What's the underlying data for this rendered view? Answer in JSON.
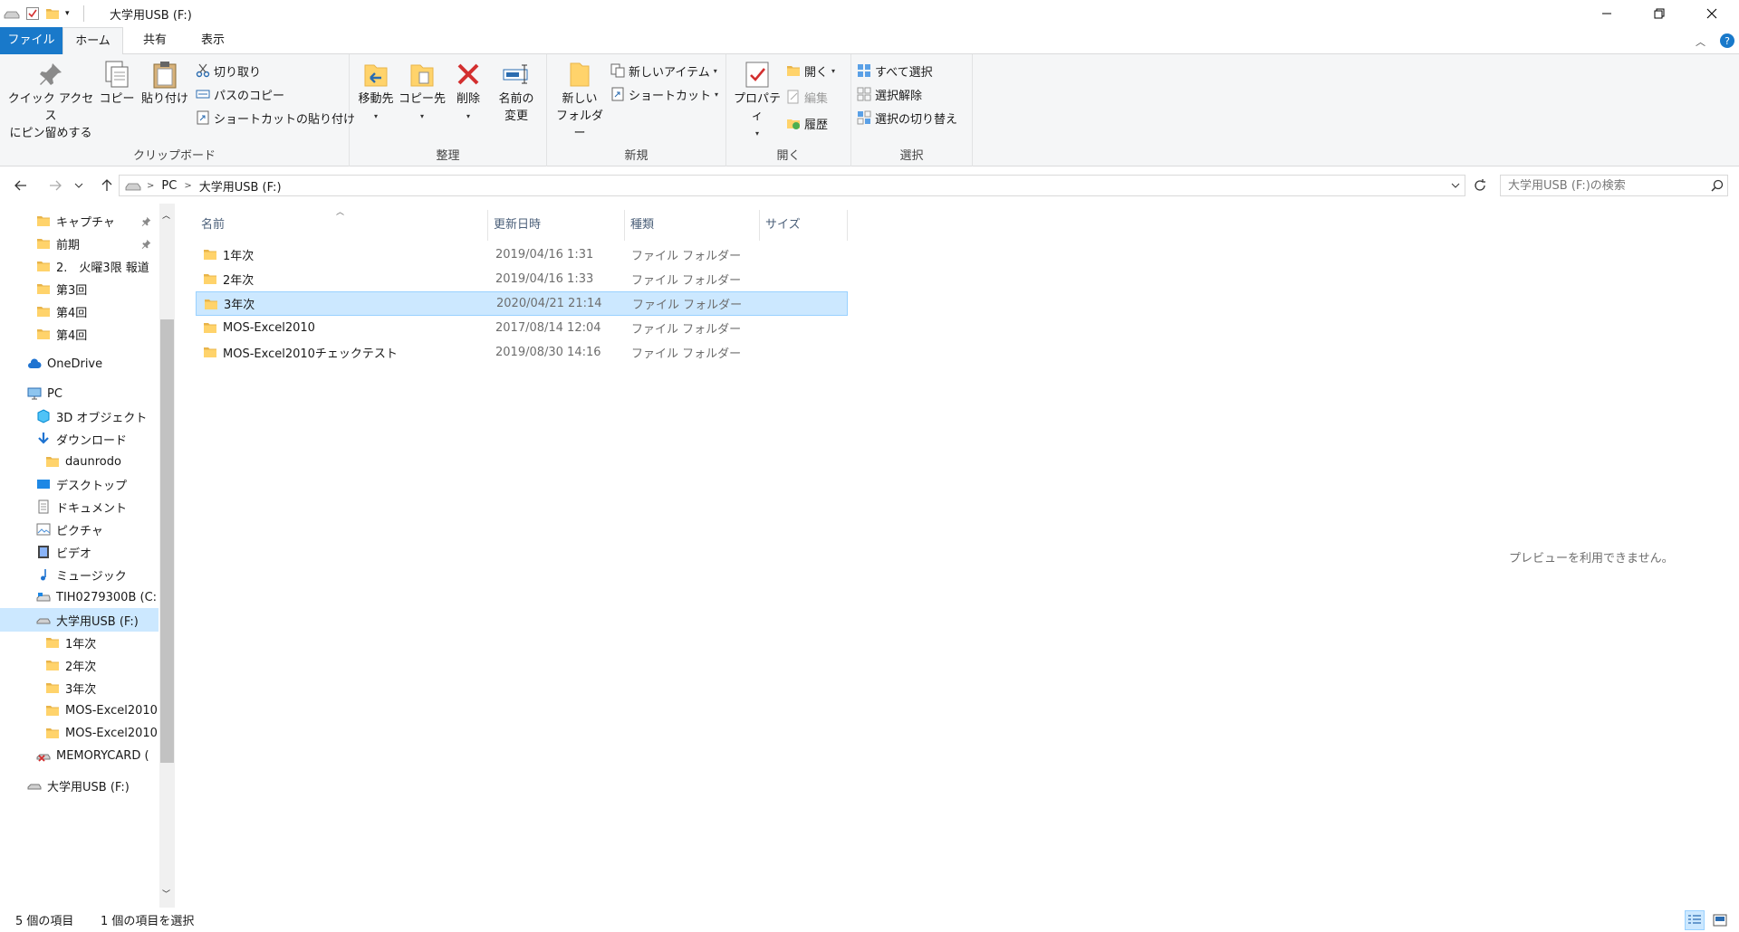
{
  "window": {
    "title": "大学用USB (F:)"
  },
  "ribbon": {
    "tabs": [
      "ファイル",
      "ホーム",
      "共有",
      "表示"
    ],
    "clipboard": {
      "pin": "クイック アクセス\nにピン留めする",
      "pin_line1": "クイック アクセス",
      "pin_line2": "にピン留めする",
      "copy": "コピー",
      "paste": "貼り付け",
      "cut": "切り取り",
      "copy_path": "パスのコピー",
      "paste_shortcut": "ショートカットの貼り付け",
      "label": "クリップボード"
    },
    "organize": {
      "move_to": "移動先",
      "copy_to": "コピー先",
      "delete": "削除",
      "rename_line1": "名前の",
      "rename_line2": "変更",
      "label": "整理"
    },
    "new": {
      "new_folder_line1": "新しい",
      "new_folder_line2": "フォルダー",
      "new_item": "新しいアイテム",
      "shortcut": "ショートカット",
      "label": "新規"
    },
    "open": {
      "properties": "プロパティ",
      "open": "開く",
      "edit": "編集",
      "history": "履歴",
      "label": "開く"
    },
    "select": {
      "select_all": "すべて選択",
      "select_none": "選択解除",
      "invert": "選択の切り替え",
      "label": "選択"
    }
  },
  "address": {
    "crumbs": [
      "PC",
      "大学用USB (F:)"
    ],
    "search_placeholder": "大学用USB (F:)の検索"
  },
  "nav": {
    "quick_access": [
      {
        "label": "キャプチャ",
        "pinned": true
      },
      {
        "label": "前期",
        "pinned": true
      },
      {
        "label": "2.　火曜3限 報道"
      },
      {
        "label": "第3回"
      },
      {
        "label": "第4回"
      },
      {
        "label": "第4回"
      }
    ],
    "onedrive": "OneDrive",
    "pc": "PC",
    "pc_items": [
      "3D オブジェクト",
      "ダウンロード",
      "daunrodo",
      "デスクトップ",
      "ドキュメント",
      "ピクチャ",
      "ビデオ",
      "ミュージック",
      "TIH0279300B (C:",
      "大学用USB (F:)",
      "1年次",
      "2年次",
      "3年次",
      "MOS-Excel2010",
      "MOS-Excel2010",
      "MEMORYCARD (",
      "大学用USB (F:)"
    ]
  },
  "columns": [
    "名前",
    "更新日時",
    "種類",
    "サイズ"
  ],
  "files": [
    {
      "name": "1年次",
      "date": "2019/04/16 1:31",
      "type": "ファイル フォルダー"
    },
    {
      "name": "2年次",
      "date": "2019/04/16 1:33",
      "type": "ファイル フォルダー"
    },
    {
      "name": "3年次",
      "date": "2020/04/21 21:14",
      "type": "ファイル フォルダー",
      "selected": true
    },
    {
      "name": "MOS-Excel2010",
      "date": "2017/08/14 12:04",
      "type": "ファイル フォルダー"
    },
    {
      "name": "MOS-Excel2010チェックテスト",
      "date": "2019/08/30 14:16",
      "type": "ファイル フォルダー"
    }
  ],
  "preview": "プレビューを利用できません。",
  "status": {
    "count": "5 個の項目",
    "selected": "1 個の項目を選択"
  },
  "colors": {
    "accent": "#1979ca",
    "selection": "#cce8ff",
    "folder": "#ffd36b"
  }
}
